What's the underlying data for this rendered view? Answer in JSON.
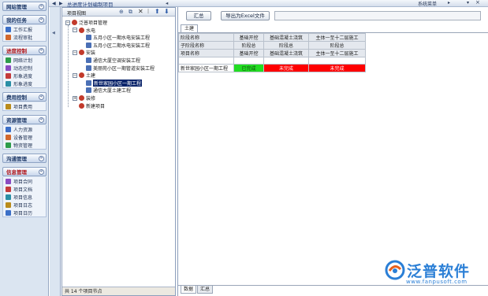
{
  "nav": {
    "groups": [
      {
        "label": "网站管理",
        "toggle": "«",
        "red": false,
        "items": []
      },
      {
        "label": "我的任务",
        "toggle": "«",
        "red": false,
        "items": [
          {
            "label": "工作汇报",
            "icon": "report-icon"
          },
          {
            "label": "流程审批",
            "icon": "approval-icon"
          }
        ]
      },
      {
        "label": "进度控制",
        "toggle": "«",
        "red": true,
        "items": [
          {
            "label": "网络计划",
            "icon": "network-plan-icon"
          },
          {
            "label": "动态控制",
            "icon": "dynamic-control-icon"
          },
          {
            "label": "形象进度",
            "icon": "image-progress-icon"
          },
          {
            "label": "形象进度",
            "icon": "progress-chart-icon"
          }
        ]
      },
      {
        "label": "费用控制",
        "toggle": "«",
        "red": false,
        "items": [
          {
            "label": "项目费用",
            "icon": "cost-icon"
          }
        ]
      },
      {
        "label": "资源管理",
        "toggle": "«",
        "red": false,
        "items": [
          {
            "label": "人力资源",
            "icon": "people-icon"
          },
          {
            "label": "设备管理",
            "icon": "equipment-icon"
          },
          {
            "label": "物资管理",
            "icon": "materials-icon"
          }
        ]
      },
      {
        "label": "沟通管理",
        "toggle": "»",
        "red": false,
        "items": []
      },
      {
        "label": "信息管理",
        "toggle": "«",
        "red": true,
        "items": [
          {
            "label": "项目合同",
            "icon": "contract-icon"
          },
          {
            "label": "项目文档",
            "icon": "document-icon"
          },
          {
            "label": "项目信息",
            "icon": "info-icon"
          },
          {
            "label": "项目日志",
            "icon": "log-icon"
          },
          {
            "label": "项目日历",
            "icon": "calendar-icon"
          }
        ]
      }
    ]
  },
  "topbar": {
    "title": "总进度计划编制项目",
    "right_label": "系统菜单"
  },
  "tree": {
    "title": "项目视图",
    "nodes": [
      {
        "label": "泛普项目管理",
        "level": 0,
        "toggle": "−",
        "selected": false
      },
      {
        "label": "水电",
        "level": 1,
        "toggle": "−",
        "selected": false
      },
      {
        "label": "五月小区一期水电安装工程",
        "level": 2,
        "toggle": "",
        "selected": false
      },
      {
        "label": "五月小区二期水电安装工程",
        "level": 2,
        "toggle": "",
        "selected": false
      },
      {
        "label": "安装",
        "level": 1,
        "toggle": "−",
        "selected": false
      },
      {
        "label": "通信大厦空调安装工程",
        "level": 2,
        "toggle": "",
        "selected": false
      },
      {
        "label": "美丽苑小区一期管道安装工程",
        "level": 2,
        "toggle": "",
        "selected": false
      },
      {
        "label": "土建",
        "level": 1,
        "toggle": "−",
        "selected": false
      },
      {
        "label": "新世家园小区一期工程",
        "level": 2,
        "toggle": "",
        "selected": true
      },
      {
        "label": "通信大厦土建工程",
        "level": 2,
        "toggle": "",
        "selected": false
      },
      {
        "label": "装修",
        "level": 1,
        "toggle": "+",
        "selected": false
      },
      {
        "label": "新建项目",
        "level": 1,
        "toggle": "",
        "selected": false
      }
    ],
    "status": "共 14 个项目节点"
  },
  "right": {
    "buttons": {
      "summary": "汇总",
      "export": "导出为Excel文件"
    },
    "tab": "土建",
    "header_rows": [
      [
        "阶段名称",
        "基础开挖",
        "基础混凝土浇筑",
        "主体一至十二层施工"
      ],
      [
        "子阶段名称",
        "阶段总",
        "阶段总",
        "阶段总"
      ],
      [
        "项目名称",
        "基础开挖",
        "基础混凝土浇筑",
        "主体一至十二层施工"
      ]
    ],
    "data_rows": [
      {
        "name": "新世家园小区一期工程",
        "cells": [
          {
            "text": "已完成",
            "status": "done"
          },
          {
            "text": "未完成",
            "status": "todo"
          },
          {
            "text": "未完成",
            "status": "todo"
          }
        ]
      }
    ],
    "status_colors": {
      "done": "#22dd22",
      "todo": "#ff0000"
    },
    "bottom_tabs": [
      "数据",
      "汇总"
    ]
  },
  "watermark": {
    "brand": "泛普软件",
    "url": "www.fanpusoft.com"
  }
}
